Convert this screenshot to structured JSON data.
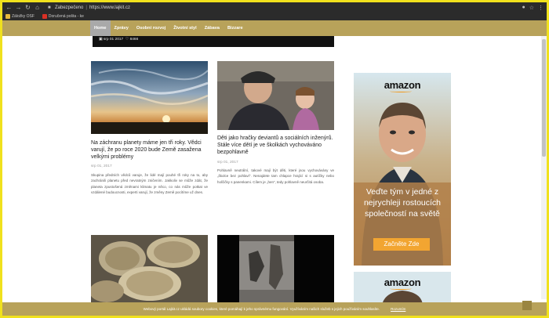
{
  "browser": {
    "secure_label": "Zabezpečeno",
    "url": "https://www.lajkit.cz",
    "bookmarks": [
      {
        "label": "Záložky OSF",
        "color": "#e6b83d"
      },
      {
        "label": "Doručená pošta - ke",
        "color": "#d93025"
      }
    ]
  },
  "nav": {
    "items": [
      {
        "label": "Home",
        "active": true
      },
      {
        "label": "Zprávy",
        "active": false
      },
      {
        "label": "Osobní rozvoj",
        "active": false
      },
      {
        "label": "Životní styl",
        "active": false
      },
      {
        "label": "Zábava",
        "active": false
      },
      {
        "label": "Bizzare",
        "active": false
      }
    ]
  },
  "hero": {
    "date": "srp 01 2017",
    "likes": "8466"
  },
  "articles": [
    {
      "title": "Na záchranu planety máme jen tři roky. Vědci varují, že po roce 2020 bude Země zasažena velkými problémy",
      "date": "srp 01, 2017",
      "excerpt": "Skupina předních vědců varuje, že lidé mají pouhé tři roky na to, aby zachránili planetu před nevratným zničením. Jakkoliv se může zdát, že planeta zpustošená změnami klimatu je něco, co nás může potkat ve vzdálené budoucnosti, experti varují, že změny Země pocítíme už dnes."
    },
    {
      "title": "Děti jako hračky deviantů a sociálních inženýrů. Stále více dětí je ve školkách vychováváno bezpohlavně",
      "date": "srp 01, 2017",
      "excerpt": "Pohlavně neutrální, takové mají být děti, které jsou vychovávány ve „školce bez pohlaví“. Nenajdete tam chlapce hrající si s autíčky nebo holčičky s panenkami. Cílem je „hen“, tedy pohlavně neurčitá osoba."
    }
  ],
  "ads": [
    {
      "brand": "amazon",
      "copy_lines": [
        "Veďte tým v jedné z",
        "nejrychleji rostoucích",
        "společností na světě"
      ],
      "cta": "Začněte Zde",
      "colors": {
        "panel": "#b78e5a",
        "button": "#f2a531"
      }
    },
    {
      "brand": "amazon"
    }
  ],
  "cookie_bar": {
    "text": "Webový portál Lajkit.cz ukládá soubory cookies, které pomáhají k jeho správnému fungování. Využíváním našich služeb s jejich používáním souhlasíte.",
    "link": "Rozumím"
  },
  "colors": {
    "header": "#b8a25a",
    "frame": "#f0e11d",
    "chrome": "#2b2b2b"
  }
}
